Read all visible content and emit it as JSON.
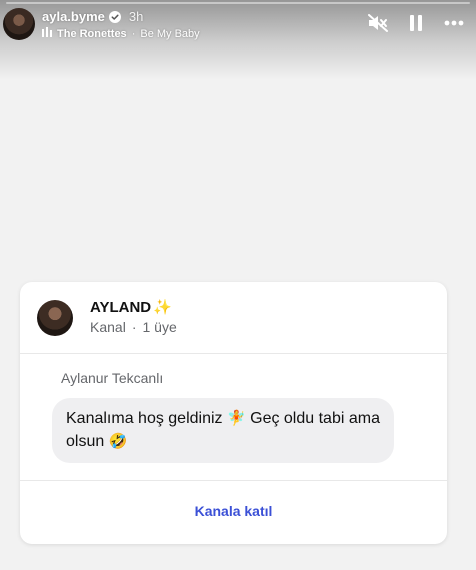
{
  "story": {
    "progress": 0.0,
    "username": "ayla.byme",
    "time": "3h",
    "music": {
      "artist": "The Ronettes",
      "separator": "·",
      "song": "Be My Baby"
    },
    "controls": [
      "mute-icon",
      "pause-icon",
      "more-icon"
    ]
  },
  "card": {
    "channel_name": "AYLAND",
    "channel_emoji": "✨",
    "channel_type": "Kanal",
    "dot": "·",
    "members": "1 üye",
    "sender": "Aylanur Tekcanlı",
    "message": {
      "part1": "Kanalıma hoş geldiniz ",
      "emoji1": "🧚",
      "part2": " Geç oldu tabi ama olsun ",
      "emoji2": "🤣"
    },
    "join_label": "Kanala katıl"
  },
  "colors": {
    "background": "#f2f2f2",
    "link": "#3b50d6",
    "bubble": "#efeff1",
    "verified": "#ffffff"
  }
}
